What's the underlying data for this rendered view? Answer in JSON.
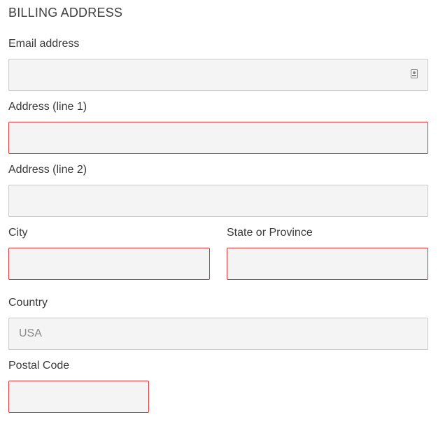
{
  "section": {
    "title": "BILLING ADDRESS"
  },
  "fields": {
    "email": {
      "label": "Email address",
      "value": "",
      "placeholder": "",
      "icon": "contact-card-icon",
      "invalid": false
    },
    "address1": {
      "label": "Address (line 1)",
      "value": "",
      "placeholder": "",
      "invalid": true
    },
    "address2": {
      "label": "Address (line 2)",
      "value": "",
      "placeholder": "",
      "invalid": false
    },
    "city": {
      "label": "City",
      "value": "",
      "placeholder": "",
      "invalid": true
    },
    "state": {
      "label": "State or Province",
      "value": "",
      "placeholder": "",
      "invalid": true
    },
    "country": {
      "label": "Country",
      "value": "",
      "placeholder": "USA",
      "invalid": false
    },
    "postal": {
      "label": "Postal Code",
      "value": "",
      "placeholder": "",
      "invalid": true
    }
  },
  "colors": {
    "field_background": "#f4f4f4",
    "field_border": "#c9c9c9",
    "invalid_border": "#d0393e",
    "text": "#3a3a3a"
  }
}
